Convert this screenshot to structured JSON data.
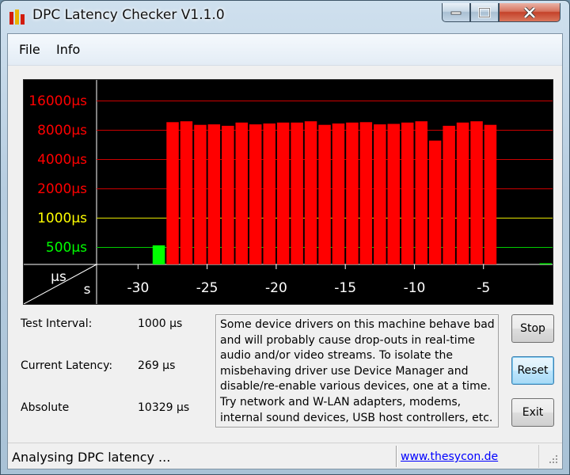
{
  "window": {
    "title": "DPC Latency Checker V1.1.0"
  },
  "menu": {
    "items": [
      "File",
      "Info"
    ]
  },
  "graph": {
    "y_tick_labels": [
      {
        "label": "16000µs",
        "color": "#ff0000"
      },
      {
        "label": "8000µs",
        "color": "#ff0000"
      },
      {
        "label": "4000µs",
        "color": "#ff0000"
      },
      {
        "label": "2000µs",
        "color": "#ff0000"
      },
      {
        "label": "1000µs",
        "color": "#ffff00"
      },
      {
        "label": "500µs",
        "color": "#00ff00"
      }
    ],
    "unit_y": "µs",
    "unit_x": "s",
    "x_tick_labels": [
      "-30",
      "-25",
      "-20",
      "-15",
      "-10",
      "-5"
    ],
    "colors": {
      "red": "#ff0000",
      "yellow": "#ffff00",
      "green": "#00ff00",
      "grid_red": "#cc0000",
      "grid_yellow": "#e6e600",
      "grid_green": "#00cc00"
    }
  },
  "chart_data": {
    "type": "bar",
    "x": [
      -32,
      -31,
      -30,
      -29,
      -28,
      -27,
      -26,
      -25,
      -24,
      -23,
      -22,
      -21,
      -20,
      -19,
      -18,
      -17,
      -16,
      -15,
      -14,
      -13,
      -12,
      -11,
      -10,
      -9,
      -8,
      -7,
      -6,
      -5,
      -4,
      -3,
      -2,
      -1,
      0
    ],
    "values": [
      280,
      230,
      240,
      520,
      9600,
      9800,
      9000,
      9100,
      8800,
      9500,
      9100,
      9300,
      9500,
      9500,
      9800,
      9000,
      9300,
      9500,
      9600,
      9100,
      9200,
      9500,
      9800,
      6200,
      8800,
      9500,
      9800,
      9000,
      290,
      250,
      240,
      340,
      280
    ],
    "xlabel": "s",
    "ylabel": "µs",
    "y_scale": "log",
    "y_ticks": [
      500,
      1000,
      2000,
      4000,
      8000,
      16000
    ],
    "xlim": [
      -33,
      0
    ],
    "grid": true,
    "thresholds": {
      "green_max": 1000,
      "yellow_max": 2000
    }
  },
  "stats": {
    "test_interval_label": "Test Interval:",
    "test_interval_value": "1000 µs",
    "current_latency_label": "Current Latency:",
    "current_latency_value": "269 µs",
    "absolute_label": "Absolute",
    "absolute_value": "10329 µs"
  },
  "info_text": "Some device drivers on this machine behave bad and will probably cause drop-outs in real-time audio and/or video streams. To isolate the misbehaving driver use Device Manager and disable/re-enable various devices, one at a time. Try network and W-LAN adapters, modems, internal sound devices, USB host controllers, etc.",
  "buttons": {
    "stop": "Stop",
    "reset": "Reset",
    "exit": "Exit"
  },
  "status": {
    "text": "Analysing DPC latency ...",
    "link": "www.thesycon.de"
  }
}
